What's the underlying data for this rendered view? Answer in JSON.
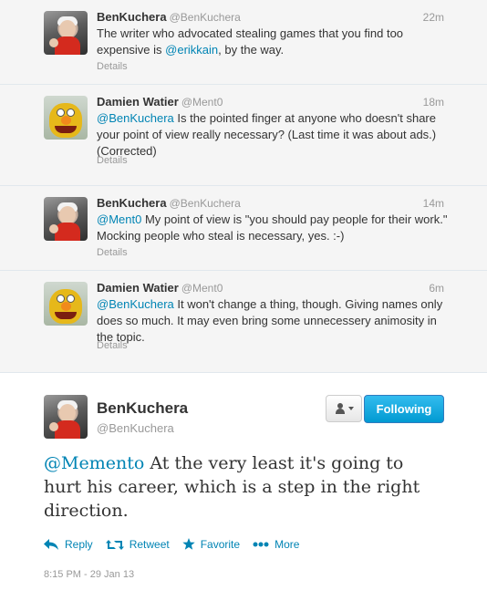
{
  "conversation": [
    {
      "author": "BenKuchera",
      "handle": "@BenKuchera",
      "time": "22m",
      "text_before": "The writer who advocated stealing games that you find too expensive is ",
      "mention": "@erikkain",
      "text_after": ", by the way.",
      "details": "Details"
    },
    {
      "author": "Damien Watier",
      "handle": "@Ment0",
      "time": "18m",
      "mention": "@BenKuchera",
      "text_after": " Is the pointed finger at anyone who doesn't share your point of view really necessary? (Last time it was about ads.) (Corrected)",
      "details": "Details"
    },
    {
      "author": "BenKuchera",
      "handle": "@BenKuchera",
      "time": "14m",
      "mention": "@Ment0",
      "text_after": " My point of view is \"you should pay people for their work.\" Mocking people who steal is necessary, yes. :-)",
      "details": "Details"
    },
    {
      "author": "Damien Watier",
      "handle": "@Ment0",
      "time": "6m",
      "mention": "@BenKuchera",
      "text_after": " It won't change a thing, though. Giving names only does so much. It may even bring some unnecessery animosity in the topic.",
      "details": "Details"
    }
  ],
  "expanded": {
    "author": "BenKuchera",
    "handle": "@BenKuchera",
    "following_label": "Following",
    "mention": "@Memento",
    "text_after": " At the very least it's going to hurt his career, which is a step in the right direction.",
    "actions": {
      "reply": "Reply",
      "retweet": "Retweet",
      "favorite": "Favorite",
      "more": "More"
    },
    "timestamp": "8:15 PM - 29 Jan 13"
  },
  "colors": {
    "link": "#0084b4",
    "muted": "#999999",
    "following_button": "#019ad2"
  }
}
